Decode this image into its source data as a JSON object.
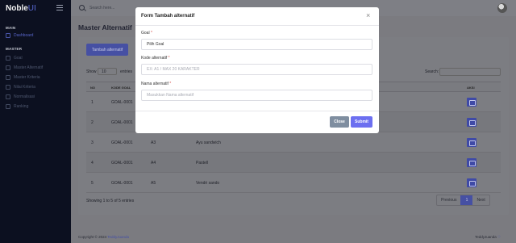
{
  "brand": {
    "name": "Noble",
    "suffix": "UI"
  },
  "sidebar": {
    "sections": [
      {
        "title": "MAIN",
        "items": [
          {
            "label": "Dashboard",
            "icon": "dashboard-icon",
            "active": true
          }
        ]
      },
      {
        "title": "MASTER",
        "items": [
          {
            "label": "Goal",
            "icon": "goal-icon"
          },
          {
            "label": "Master Alternatif",
            "icon": "list-icon"
          },
          {
            "label": "Master Kriteria",
            "icon": "list-icon"
          },
          {
            "label": "Nilai Kriteria",
            "icon": "grid-icon"
          },
          {
            "label": "Normalisasi",
            "icon": "chart-icon"
          },
          {
            "label": "Ranking",
            "icon": "trophy-icon"
          }
        ]
      }
    ]
  },
  "topbar": {
    "search_placeholder": "Search here..."
  },
  "page": {
    "title": "Master Alternatif",
    "add_button": "Tambah alternatif",
    "show_label": "Show",
    "page_size": "10",
    "entries_label": "entries",
    "search_label": "Search:"
  },
  "table": {
    "headers": [
      "NO",
      "KODE GOAL",
      "",
      "",
      "AKSI"
    ],
    "rows": [
      {
        "no": "1",
        "kode_goal": "GOAL-0001",
        "kode": "",
        "nama": ""
      },
      {
        "no": "2",
        "kode_goal": "GOAL-0001",
        "kode": "",
        "nama": ""
      },
      {
        "no": "3",
        "kode_goal": "GOAL-0001",
        "kode": "A3",
        "nama": "Ayu sandwich"
      },
      {
        "no": "4",
        "kode_goal": "GOAL-0001",
        "kode": "A4",
        "nama": "Pastell"
      },
      {
        "no": "5",
        "kode_goal": "GOAL-0001",
        "kode": "A5",
        "nama": "Vendri sando"
      }
    ]
  },
  "pagination": {
    "info": "Showing 1 to 5 of 5 entries",
    "previous": "Previous",
    "current": "1",
    "next": "Next"
  },
  "footer": {
    "copyright": "Copyright © 2024",
    "brand": "TeddyJuanda",
    "right": "TeddyJuanda"
  },
  "modal": {
    "title": "Form Tambah alternatif",
    "close_glyph": "×",
    "goal_label": "Goal",
    "goal_value": "Pilih Goal",
    "kode_label": "Kode alternatif",
    "kode_placeholder": "EX: A1 / MAX 20 KARAKTER",
    "nama_label": "Nama alternatif",
    "nama_placeholder": "Masukkan Nama alternatif",
    "required_mark": "*",
    "close_button": "Close",
    "submit_button": "Submit"
  },
  "colors": {
    "accent": "#6c6ff0",
    "sidebar_bg": "#0c1020",
    "close_button": "#7f8ea0"
  }
}
